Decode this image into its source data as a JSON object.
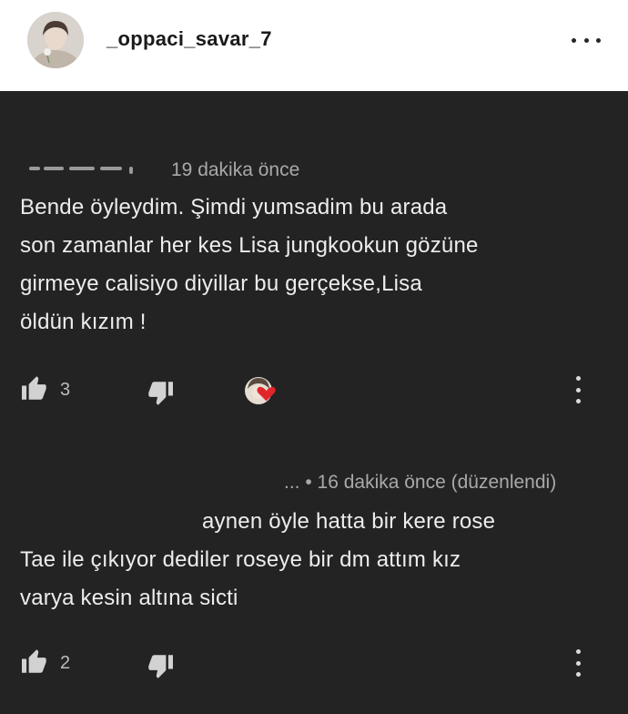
{
  "post": {
    "username": "_oppaci_savar_7"
  },
  "comments": [
    {
      "timestamp": "19 dakika önce",
      "lines": [
        "Bende öyleydim. Şimdi yumsadim bu arada",
        "son zamanlar her kes Lisa jungkookun gözüne",
        "girmeye calisiyo diyillar bu gerçekse,Lisa",
        "öldün kızım !"
      ],
      "likes": "3"
    },
    {
      "timestamp": "... • 16 dakika önce (düzenlendi)",
      "lines": [
        "aynen öyle hatta bir kere rose",
        "Tae ile çıkıyor dediler roseye bir dm attım kız",
        "varya kesin altına sicti"
      ],
      "likes": "2"
    }
  ],
  "colors": {
    "background": "#232323",
    "text": "#ededed",
    "meta": "#a9a9a9",
    "heart": "#e0262b"
  },
  "icons": [
    "thumbs-up-icon",
    "thumbs-down-icon",
    "more-vertical-icon",
    "creator-heart-icon",
    "more-horizontal-icon"
  ]
}
